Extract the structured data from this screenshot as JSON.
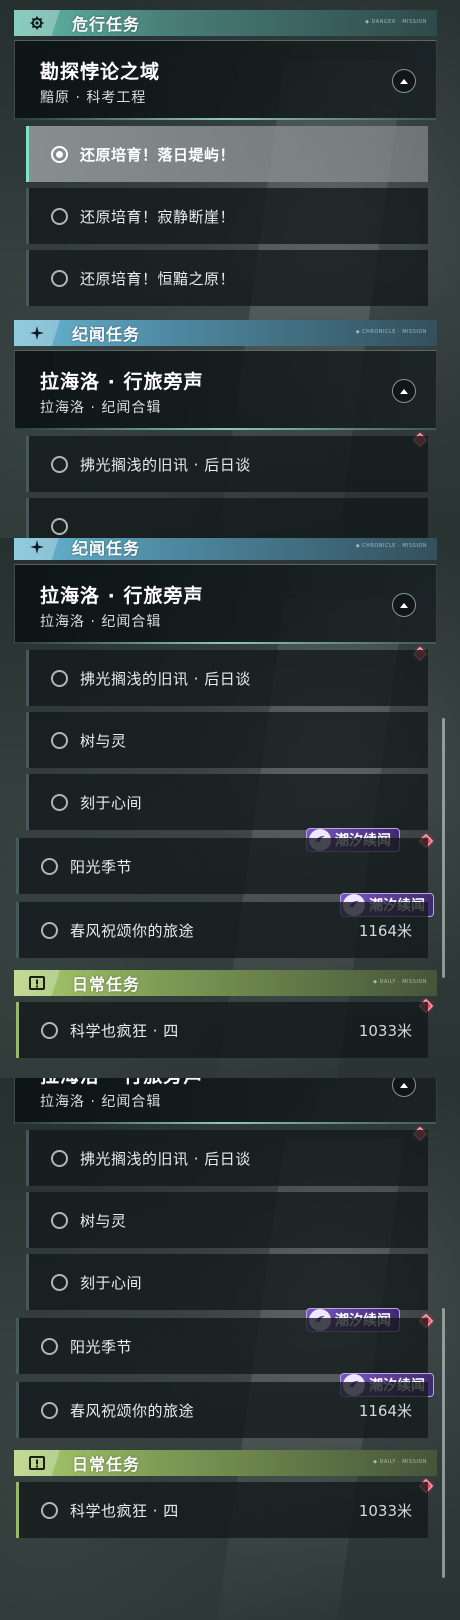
{
  "colors": {
    "danger_section": "#5fb9a9",
    "chronicle_section": "#67b7d3",
    "daily_section": "#a9cc6c",
    "event_tag": "#7b56bf",
    "marker": "#e4566c"
  },
  "sections": {
    "danger": {
      "title": "危行任务",
      "sub": "◆ DANGER · MISSION",
      "icon": "gear-emblem-icon"
    },
    "chronicle": {
      "title": "纪闻任务",
      "sub": "◆ CHRONICLE · MISSION",
      "icon": "sparkle-icon"
    },
    "daily": {
      "title": "日常任务",
      "sub": "◆ DAILY · MISSION",
      "icon": "exclamation-icon"
    }
  },
  "cards": {
    "paradox": {
      "title": "勘探悖论之域",
      "subtitle": "黯原 · 科考工程"
    },
    "lahailuo": {
      "title": "拉海洛 · 行旅旁声",
      "subtitle": "拉海洛 · 纪闻合辑"
    }
  },
  "quests": {
    "d1": "还原培育！落日堤屿！",
    "d2": "还原培育！寂静断崖！",
    "d3": "还原培育！恒黯之原！",
    "c1": "拂光搁浅的旧讯 · 后日谈",
    "c2": "树与灵",
    "c3": "刻于心间",
    "c4": "阳光季节",
    "c5": "春风祝颂你的旅途",
    "daily1": "科学也疯狂 · 四"
  },
  "distances": {
    "c5": "1164米",
    "daily1": "1033米"
  },
  "event_tag": {
    "label": "潮汐续闻",
    "icon": "tide-event-icon"
  }
}
